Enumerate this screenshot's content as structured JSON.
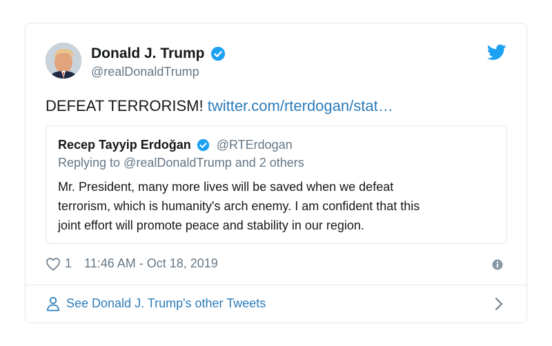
{
  "tweet": {
    "author": {
      "name": "Donald J. Trump",
      "handle": "@realDonaldTrump",
      "verified": true
    },
    "text": "DEFEAT TERRORISM! ",
    "link": "twitter.com/rterdogan/stat…",
    "quoted": {
      "name": "Recep Tayyip Erdoğan",
      "handle": "@RTErdogan",
      "verified": true,
      "replying_to": "Replying to @realDonaldTrump and 2 others",
      "body_lines": [
        "Mr. President, many more lives will be saved when we defeat",
        "terrorism, which is humanity's arch enemy. I am confident that this",
        "joint effort will promote peace and stability in our region."
      ]
    },
    "likes": "1",
    "timestamp": "11:46 AM - Oct 18, 2019",
    "footer_link": "See Donald J. Trump's other Tweets"
  },
  "icons": {
    "brand": "twitter-bird-icon",
    "verified": "verified-badge-icon",
    "like": "heart-icon",
    "info": "info-icon",
    "person": "person-icon",
    "chevron": "chevron-right-icon"
  },
  "colors": {
    "accent": "#1da1f2",
    "link": "#2b7bb9",
    "text": "#14171a",
    "muted": "#657786",
    "border": "#e1e8ed"
  }
}
